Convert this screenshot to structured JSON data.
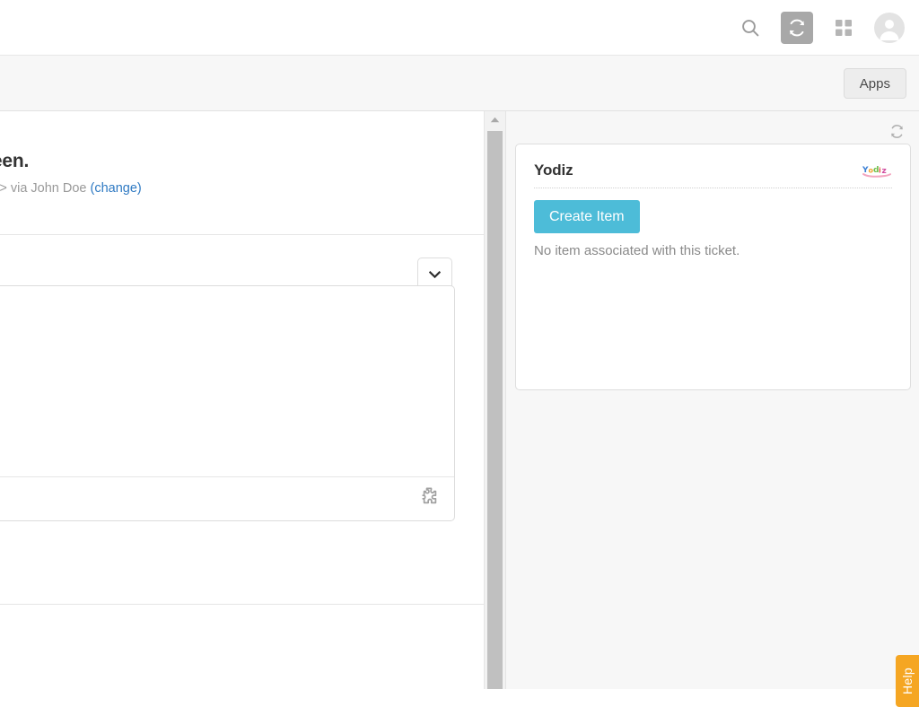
{
  "topbar": {
    "icons": [
      {
        "name": "search-icon",
        "label": "Search"
      },
      {
        "name": "refresh-icon",
        "label": "Refresh"
      },
      {
        "name": "grid-apps-icon",
        "label": "Products"
      },
      {
        "name": "user-avatar-icon",
        "label": "Account"
      }
    ]
  },
  "subheader": {
    "apps_button_label": "Apps"
  },
  "ticket": {
    "subject": "nain screen.",
    "requester_prefix": "vey@gmail.com> via John Doe ",
    "change_link": "(change)",
    "collapse_icon": "chevron-down-icon",
    "compose_toolbar_icon": "puzzle-apps-icon"
  },
  "scrollbar": {
    "up_arrow_icon": "scroll-up-arrow-icon"
  },
  "apps_panel": {
    "refresh_icon": "refresh-icon",
    "card": {
      "title": "Yodiz",
      "logo_name": "yodiz-logo",
      "create_button_label": "Create Item",
      "empty_state_text": "No item associated with this ticket."
    }
  },
  "help_tab": {
    "label": "Help"
  },
  "colors": {
    "accent_button": "#4dbcd8",
    "help_tab": "#f5a623",
    "link": "#2f7ac3",
    "panel_bg": "#f7f7f7",
    "active_icon_bg": "#a8a8a8"
  }
}
